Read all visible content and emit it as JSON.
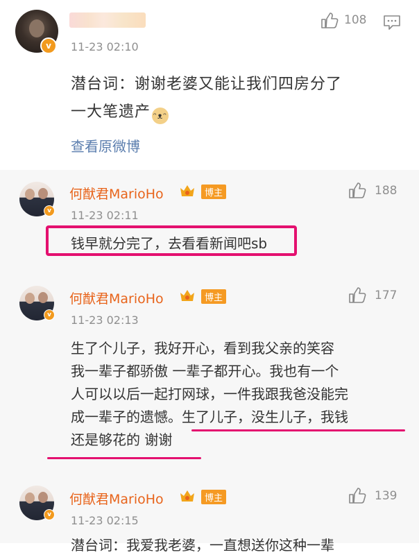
{
  "post": {
    "time": "11-23 02:10",
    "likes": "108",
    "text_line1": "潜台词：谢谢老婆又能让我们四房分了",
    "text_line2": "一大笔遗产",
    "view_original": "查看原微博"
  },
  "replies": [
    {
      "name": "何猷君MarioHo",
      "badge": "博主",
      "time": "11-23 02:11",
      "likes": "188",
      "lines": [
        "钱早就分完了，去看看新闻吧sb"
      ]
    },
    {
      "name": "何猷君MarioHo",
      "badge": "博主",
      "time": "11-23 02:13",
      "likes": "177",
      "lines": [
        "生了个儿子，我好开心，看到我父亲的笑容",
        "我一辈子都骄傲 一辈子都开心。我也有一个",
        "人可以以后一起打网球，一件我跟我爸没能完",
        "成一辈子的遗憾。生了儿子，没生儿子，我钱",
        "还是够花的 谢谢"
      ]
    },
    {
      "name": "何猷君MarioHo",
      "badge": "博主",
      "time": "11-23 02:15",
      "likes": "139",
      "lines": [
        "潜台词：我爱我老婆，一直想送你这种一辈"
      ]
    }
  ],
  "colors": {
    "name_orange": "#e8641b",
    "link_blue": "#5b7eae",
    "highlight_pink": "#e4106f",
    "verified_orange": "#f29a1e"
  },
  "icons": [
    "thumbs-up-icon",
    "comment-icon",
    "verified-icon",
    "crown-icon"
  ]
}
